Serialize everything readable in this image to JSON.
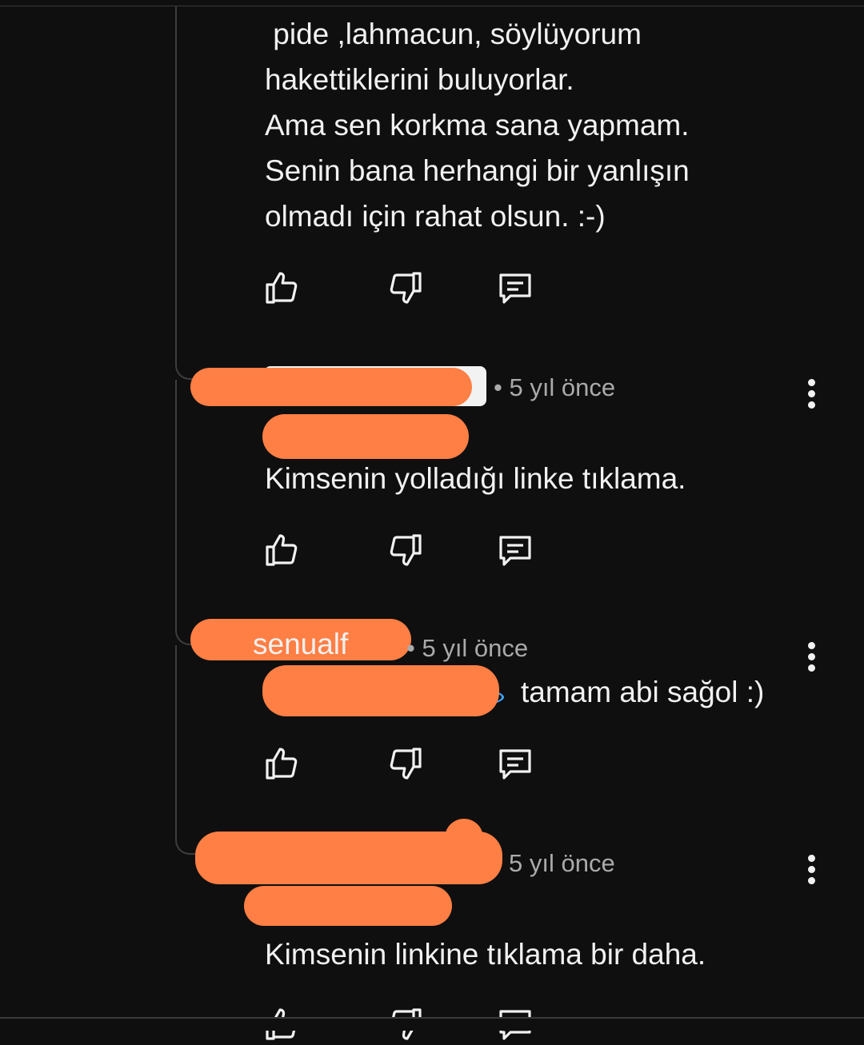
{
  "comment_top": {
    "lines": [
      " pide ,lahmacun, söylüyorum",
      "hakettiklerini buluyorlar.",
      "Ama sen korkma sana yapmam.",
      "Senin bana herhangi bir yanlışın",
      "olmadı için rahat olsun. :-)"
    ]
  },
  "replies": [
    {
      "time": "• 5 yıl önce",
      "text": "Kimsenin yolladığı linke tıklama."
    },
    {
      "author": "senualf",
      "time": "• 5 yıl önce",
      "text": "tamam abi sağol :)"
    },
    {
      "time": "5 yıl önce",
      "text": "Kimsenin linkine tıklama bir daha."
    }
  ],
  "icons": {
    "like": "thumbs-up-icon",
    "dislike": "thumbs-down-icon",
    "reply": "comment-reply-icon",
    "more": "more-vert-icon"
  },
  "colors": {
    "background": "#0f0f0f",
    "text": "#f1f1f1",
    "meta": "#aaaaaa",
    "redaction": "#ff7f45"
  }
}
